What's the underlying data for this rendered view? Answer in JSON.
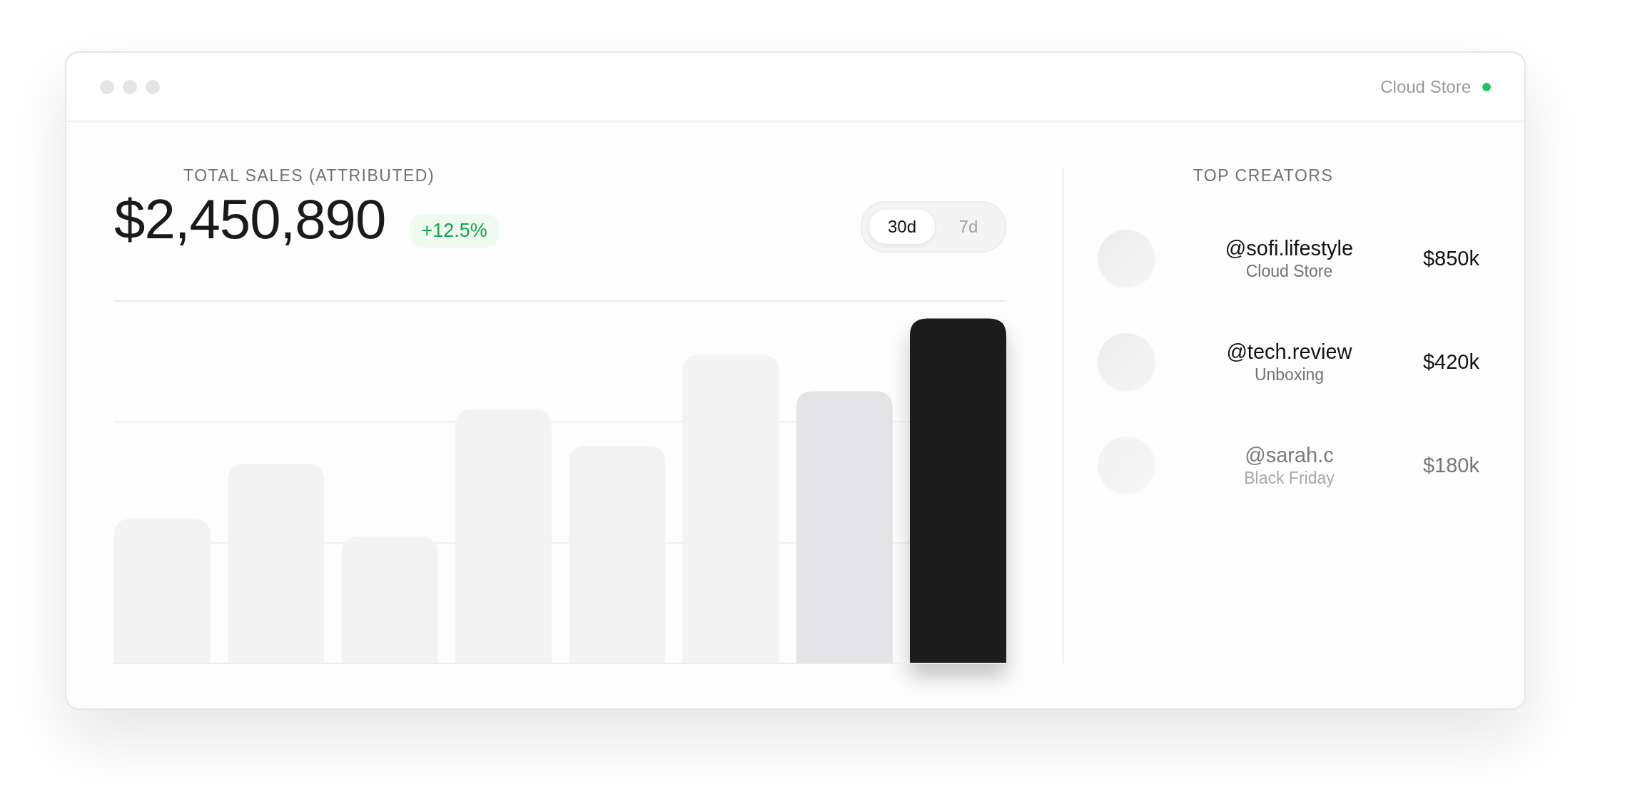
{
  "window": {
    "store": "Cloud Store",
    "online": true
  },
  "sales": {
    "label": "TOTAL SALES (ATTRIBUTED)",
    "total": "$2,450,890",
    "change": "+12.5%"
  },
  "ranges": [
    {
      "label": "30d",
      "selected": true
    },
    {
      "label": "7d",
      "selected": false
    }
  ],
  "creators": {
    "title": "TOP CREATORS",
    "items": [
      {
        "handle": "@sofi.lifestyle",
        "campaign": "Cloud Store",
        "amount": "$850k",
        "faded": false
      },
      {
        "handle": "@tech.review",
        "campaign": "Unboxing",
        "amount": "$420k",
        "faded": false
      },
      {
        "handle": "@sarah.c",
        "campaign": "Black Friday",
        "amount": "$180k",
        "faded": true
      }
    ]
  }
}
